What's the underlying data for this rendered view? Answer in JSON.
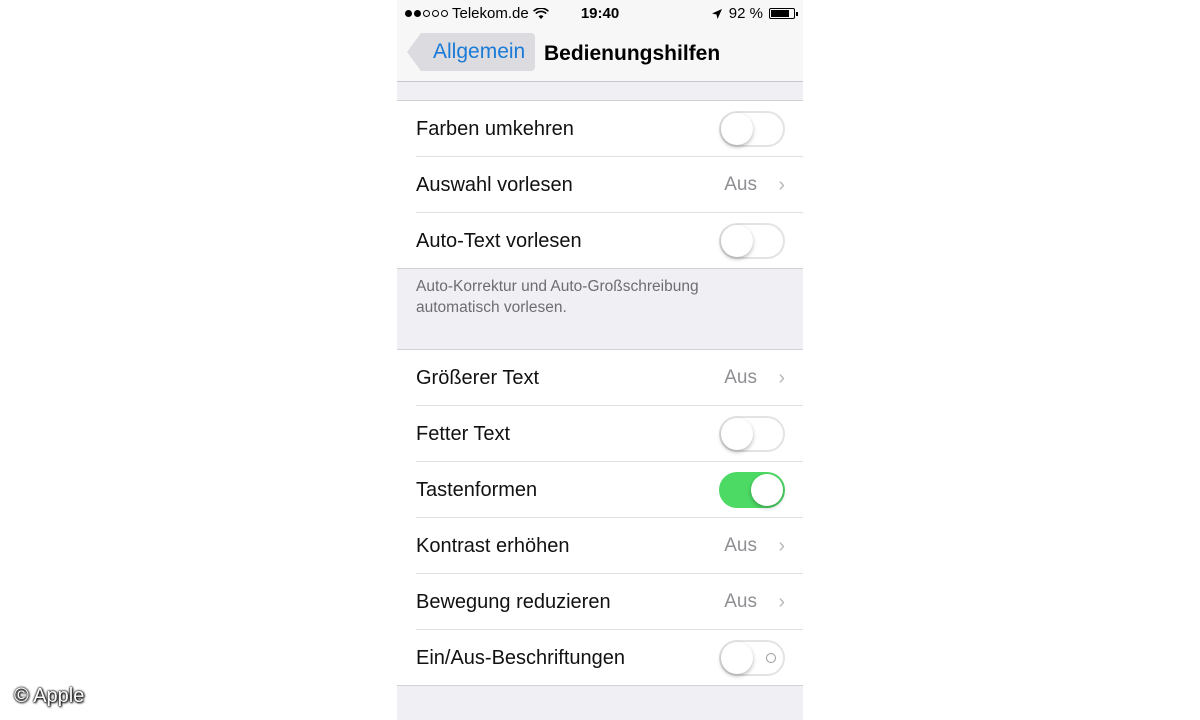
{
  "status": {
    "carrier": "Telekom.de",
    "time": "19:40",
    "battery": "92 %",
    "battery_level": 0.92,
    "signal_dots_filled": 2,
    "signal_dots_total": 5
  },
  "nav": {
    "back_label": "Allgemein",
    "title": "Bedienungshilfen"
  },
  "group1": {
    "rows": [
      {
        "label": "Farben umkehren",
        "type": "toggle",
        "on": false
      },
      {
        "label": "Auswahl vorlesen",
        "type": "value",
        "value": "Aus"
      },
      {
        "label": "Auto-Text vorlesen",
        "type": "toggle",
        "on": false
      }
    ],
    "footer": "Auto-Korrektur und Auto-Großschreibung automatisch vorlesen."
  },
  "group2": {
    "rows": [
      {
        "label": "Größerer Text",
        "type": "value",
        "value": "Aus"
      },
      {
        "label": "Fetter Text",
        "type": "toggle",
        "on": false
      },
      {
        "label": "Tastenformen",
        "type": "toggle",
        "on": true
      },
      {
        "label": "Kontrast erhöhen",
        "type": "value",
        "value": "Aus"
      },
      {
        "label": "Bewegung reduzieren",
        "type": "value",
        "value": "Aus"
      },
      {
        "label": "Ein/Aus-Beschriftungen",
        "type": "toggle",
        "on": false,
        "show_off_label": true
      }
    ]
  },
  "credit": "© Apple",
  "colors": {
    "accent": "#1a7ad8",
    "toggle_on": "#4cd964",
    "background": "#efeff4"
  }
}
